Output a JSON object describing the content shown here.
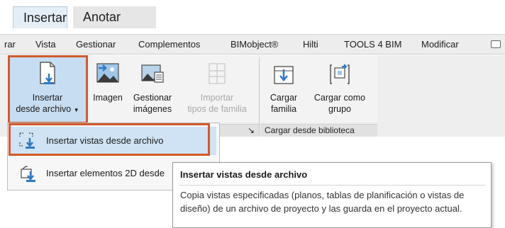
{
  "top_tabs": [
    {
      "label": "Insertar",
      "active": true
    },
    {
      "label": "Anotar",
      "active": false
    }
  ],
  "ribbon_tabs": [
    "rar",
    "Vista",
    "Gestionar",
    "Complementos",
    "BIMobject®",
    "Hilti",
    "TOOLS 4 BIM",
    "Modificar"
  ],
  "ribbon": {
    "buttons": {
      "insertar": {
        "line1": "Insertar",
        "line2": "desde archivo",
        "dropdown_icon": "chevron-down-icon"
      },
      "imagen": {
        "line1": "Imagen"
      },
      "gestionar": {
        "line1": "Gestionar",
        "line2": "imágenes"
      },
      "importar": {
        "line1": "Importar",
        "line2": "tipos de familia",
        "disabled": true
      },
      "cargar_familia": {
        "line1": "Cargar",
        "line2": "familia"
      },
      "cargar_grupo": {
        "line1": "Cargar como",
        "line2": "grupo"
      }
    },
    "panel_label_expand": "↘",
    "panel_label_2": "Cargar desde biblioteca"
  },
  "dropdown": {
    "items": [
      {
        "label": "Insertar vistas desde archivo",
        "icon": "insert-views-icon",
        "highlighted": true
      },
      {
        "label": "Insertar elementos 2D desde",
        "icon": "insert-2d-icon",
        "highlighted": false
      }
    ]
  },
  "tooltip": {
    "title": "Insertar vistas desde archivo",
    "body": "Copia vistas especificadas (planos, tablas de planificación o vistas de diseño) de un archivo de proyecto y las guarda en el proyecto actual."
  },
  "colors": {
    "highlight_frame": "#d2592d",
    "selected_bg": "#cfe3f4",
    "accent_blue": "#2f79c5"
  }
}
